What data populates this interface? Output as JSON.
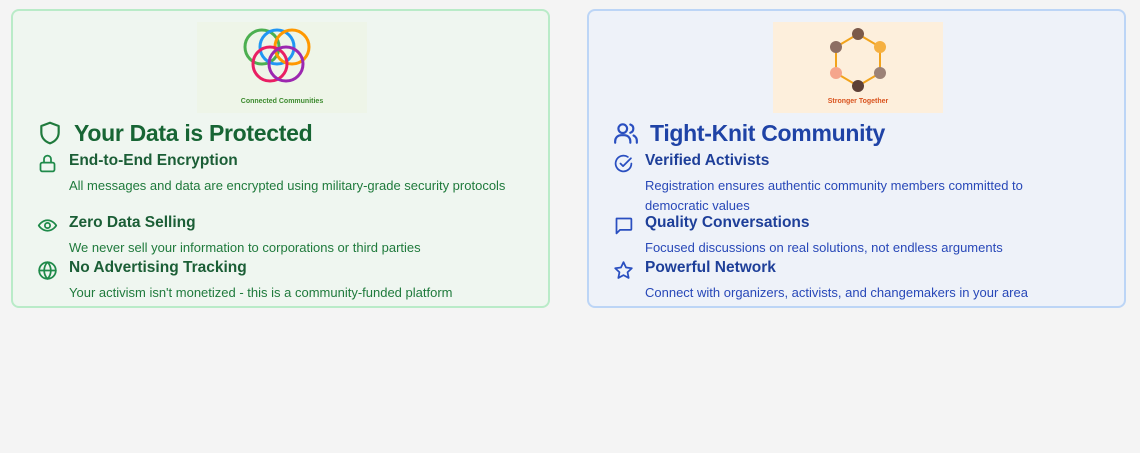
{
  "colors": {
    "green_accent": "#1f8a4a",
    "blue_accent": "#2a4fc0",
    "page_bg": "#f4f4f4"
  },
  "left_card": {
    "logo_caption": "Connected Communities",
    "title": "Your Data is Protected",
    "title_icon": "shield-icon",
    "features": [
      {
        "icon": "lock-icon",
        "heading": "End-to-End Encryption",
        "description": "All messages and data are encrypted using military-grade security protocols"
      },
      {
        "icon": "eye-icon",
        "heading": "Zero Data Selling",
        "description": "We never sell your information to corporations or third parties"
      },
      {
        "icon": "globe-icon",
        "heading": "No Advertising Tracking",
        "description": "Your activism isn't monetized - this is a community-funded platform"
      }
    ]
  },
  "right_card": {
    "logo_caption": "Stronger Together",
    "title": "Tight-Knit Community",
    "title_icon": "users-icon",
    "features": [
      {
        "icon": "check-circle-icon",
        "heading": "Verified Activists",
        "description": "Registration ensures authentic community members committed to democratic values"
      },
      {
        "icon": "chat-icon",
        "heading": "Quality Conversations",
        "description": "Focused discussions on real solutions, not endless arguments"
      },
      {
        "icon": "star-icon",
        "heading": "Powerful Network",
        "description": "Connect with organizers, activists, and changemakers in your area"
      }
    ]
  }
}
